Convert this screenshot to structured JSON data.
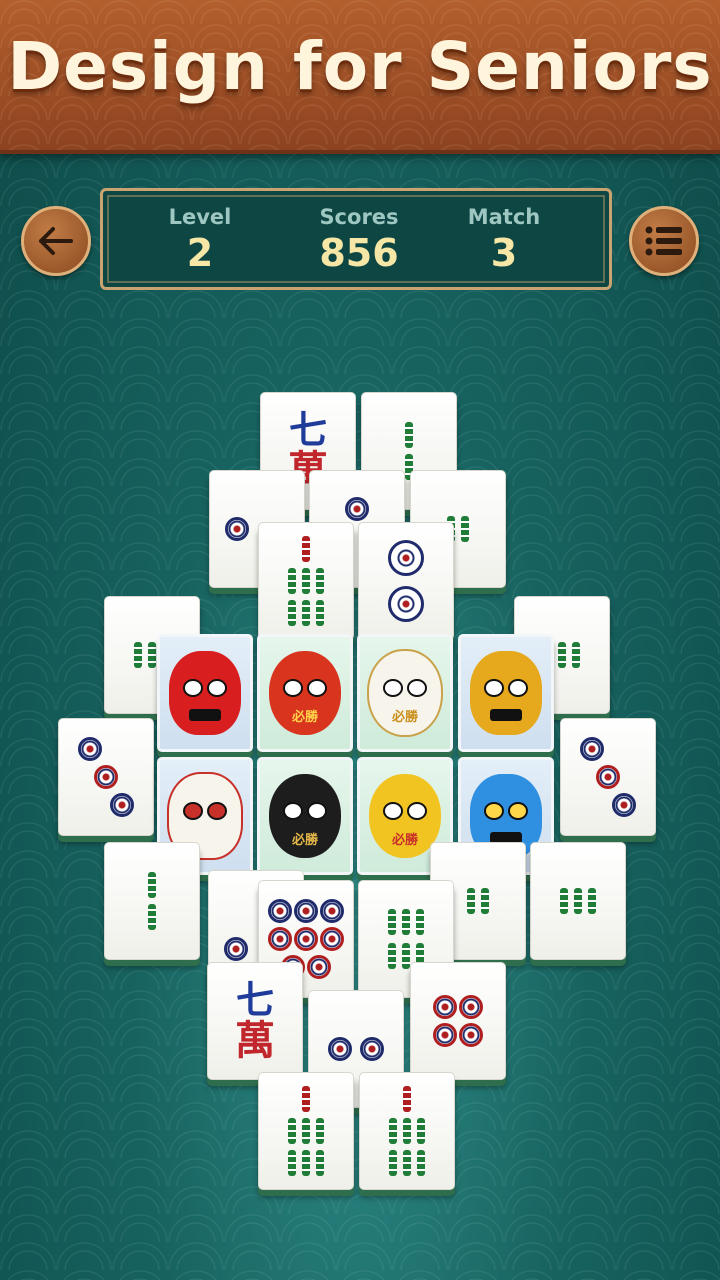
{
  "banner": {
    "title": "Design for Seniors"
  },
  "nav": {
    "back_icon": "arrow-left-icon",
    "menu_icon": "list-menu-icon"
  },
  "stats": {
    "level_label": "Level",
    "level_value": "2",
    "scores_label": "Scores",
    "scores_value": "856",
    "match_label": "Match",
    "match_value": "3"
  },
  "tiles": {
    "character_glyph_top": "七",
    "character_glyph_bottom": "萬",
    "daruma_text": "必勝"
  },
  "colors": {
    "banner": "#9c4f25",
    "felt": "#17625f",
    "panel": "#0e4644",
    "panel_border": "#c9a471",
    "stat_value": "#f6e7a6",
    "bamboo_green": "#1f7d38",
    "dot_blue": "#1f2b6b",
    "character_red": "#c0262c"
  },
  "masks": [
    "red-tengu-mask-icon",
    "red-daruma-icon",
    "white-daruma-icon",
    "gold-oni-mask-icon",
    "kitsune-fox-mask-icon",
    "black-daruma-icon",
    "yellow-daruma-icon",
    "blue-oni-mask-icon"
  ]
}
